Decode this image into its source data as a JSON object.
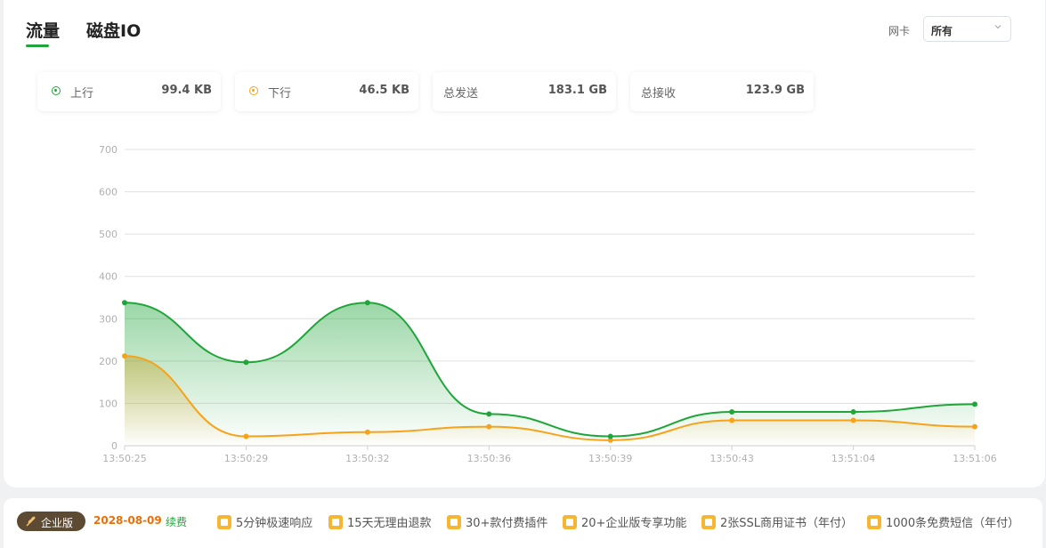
{
  "tabs": [
    {
      "label": "流量",
      "active": true
    },
    {
      "label": "磁盘IO",
      "active": false
    }
  ],
  "nic": {
    "label": "网卡",
    "selected": "所有"
  },
  "stats": {
    "up_label": "上行",
    "up_value": "99.4 KB",
    "down_label": "下行",
    "down_value": "46.5 KB",
    "sent_label": "总发送",
    "sent_value": "183.1 GB",
    "recv_label": "总接收",
    "recv_value": "123.9 GB"
  },
  "colors": {
    "accent": "#20a53a",
    "upload": "#20a53a",
    "download": "#f6a21a"
  },
  "chart_data": {
    "type": "area",
    "x": [
      "13:50:25",
      "13:50:29",
      "13:50:32",
      "13:50:36",
      "13:50:39",
      "13:50:43",
      "13:51:04",
      "13:51:06"
    ],
    "yticks": [
      "0",
      "100",
      "200",
      "300",
      "400",
      "500",
      "600",
      "700"
    ],
    "ylim": [
      0,
      700
    ],
    "grid": true,
    "series": [
      {
        "key": "up",
        "values": [
          338,
          197,
          338,
          75,
          22,
          80,
          80,
          98
        ],
        "color": "#20a53a"
      },
      {
        "key": "down",
        "values": [
          212,
          22,
          32,
          45,
          13,
          60,
          60,
          45
        ],
        "color": "#f6a21a"
      }
    ]
  },
  "footer": {
    "edition": "企业版",
    "expire_date": "2028-08-09",
    "renew": "续费",
    "features": [
      "5分钟极速响应",
      "15天无理由退款",
      "30+款付费插件",
      "20+企业版专享功能",
      "2张SSL商用证书（年付）",
      "1000条免费短信（年付）"
    ]
  }
}
